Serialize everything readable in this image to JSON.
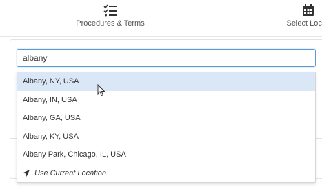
{
  "steps": {
    "procedures": {
      "label": "Procedures & Terms",
      "icon": "checklist-icon"
    },
    "location": {
      "label": "Select Locati",
      "icon": "calendar-icon"
    }
  },
  "search": {
    "value": "albany",
    "placeholder": ""
  },
  "dropdown": {
    "options": [
      {
        "label": "Albany, NY, USA",
        "highlighted": true
      },
      {
        "label": "Albany, IN, USA",
        "highlighted": false
      },
      {
        "label": "Albany, GA, USA",
        "highlighted": false
      },
      {
        "label": "Albany, KY, USA",
        "highlighted": false
      },
      {
        "label": "Albany Park, Chicago, IL, USA",
        "highlighted": false
      }
    ],
    "current_location": {
      "label": "Use Current Location",
      "icon": "navigation-arrow-icon"
    }
  },
  "colors": {
    "highlight": "#d9e7f7",
    "input_border": "#5b9bd5",
    "text": "#333333"
  }
}
